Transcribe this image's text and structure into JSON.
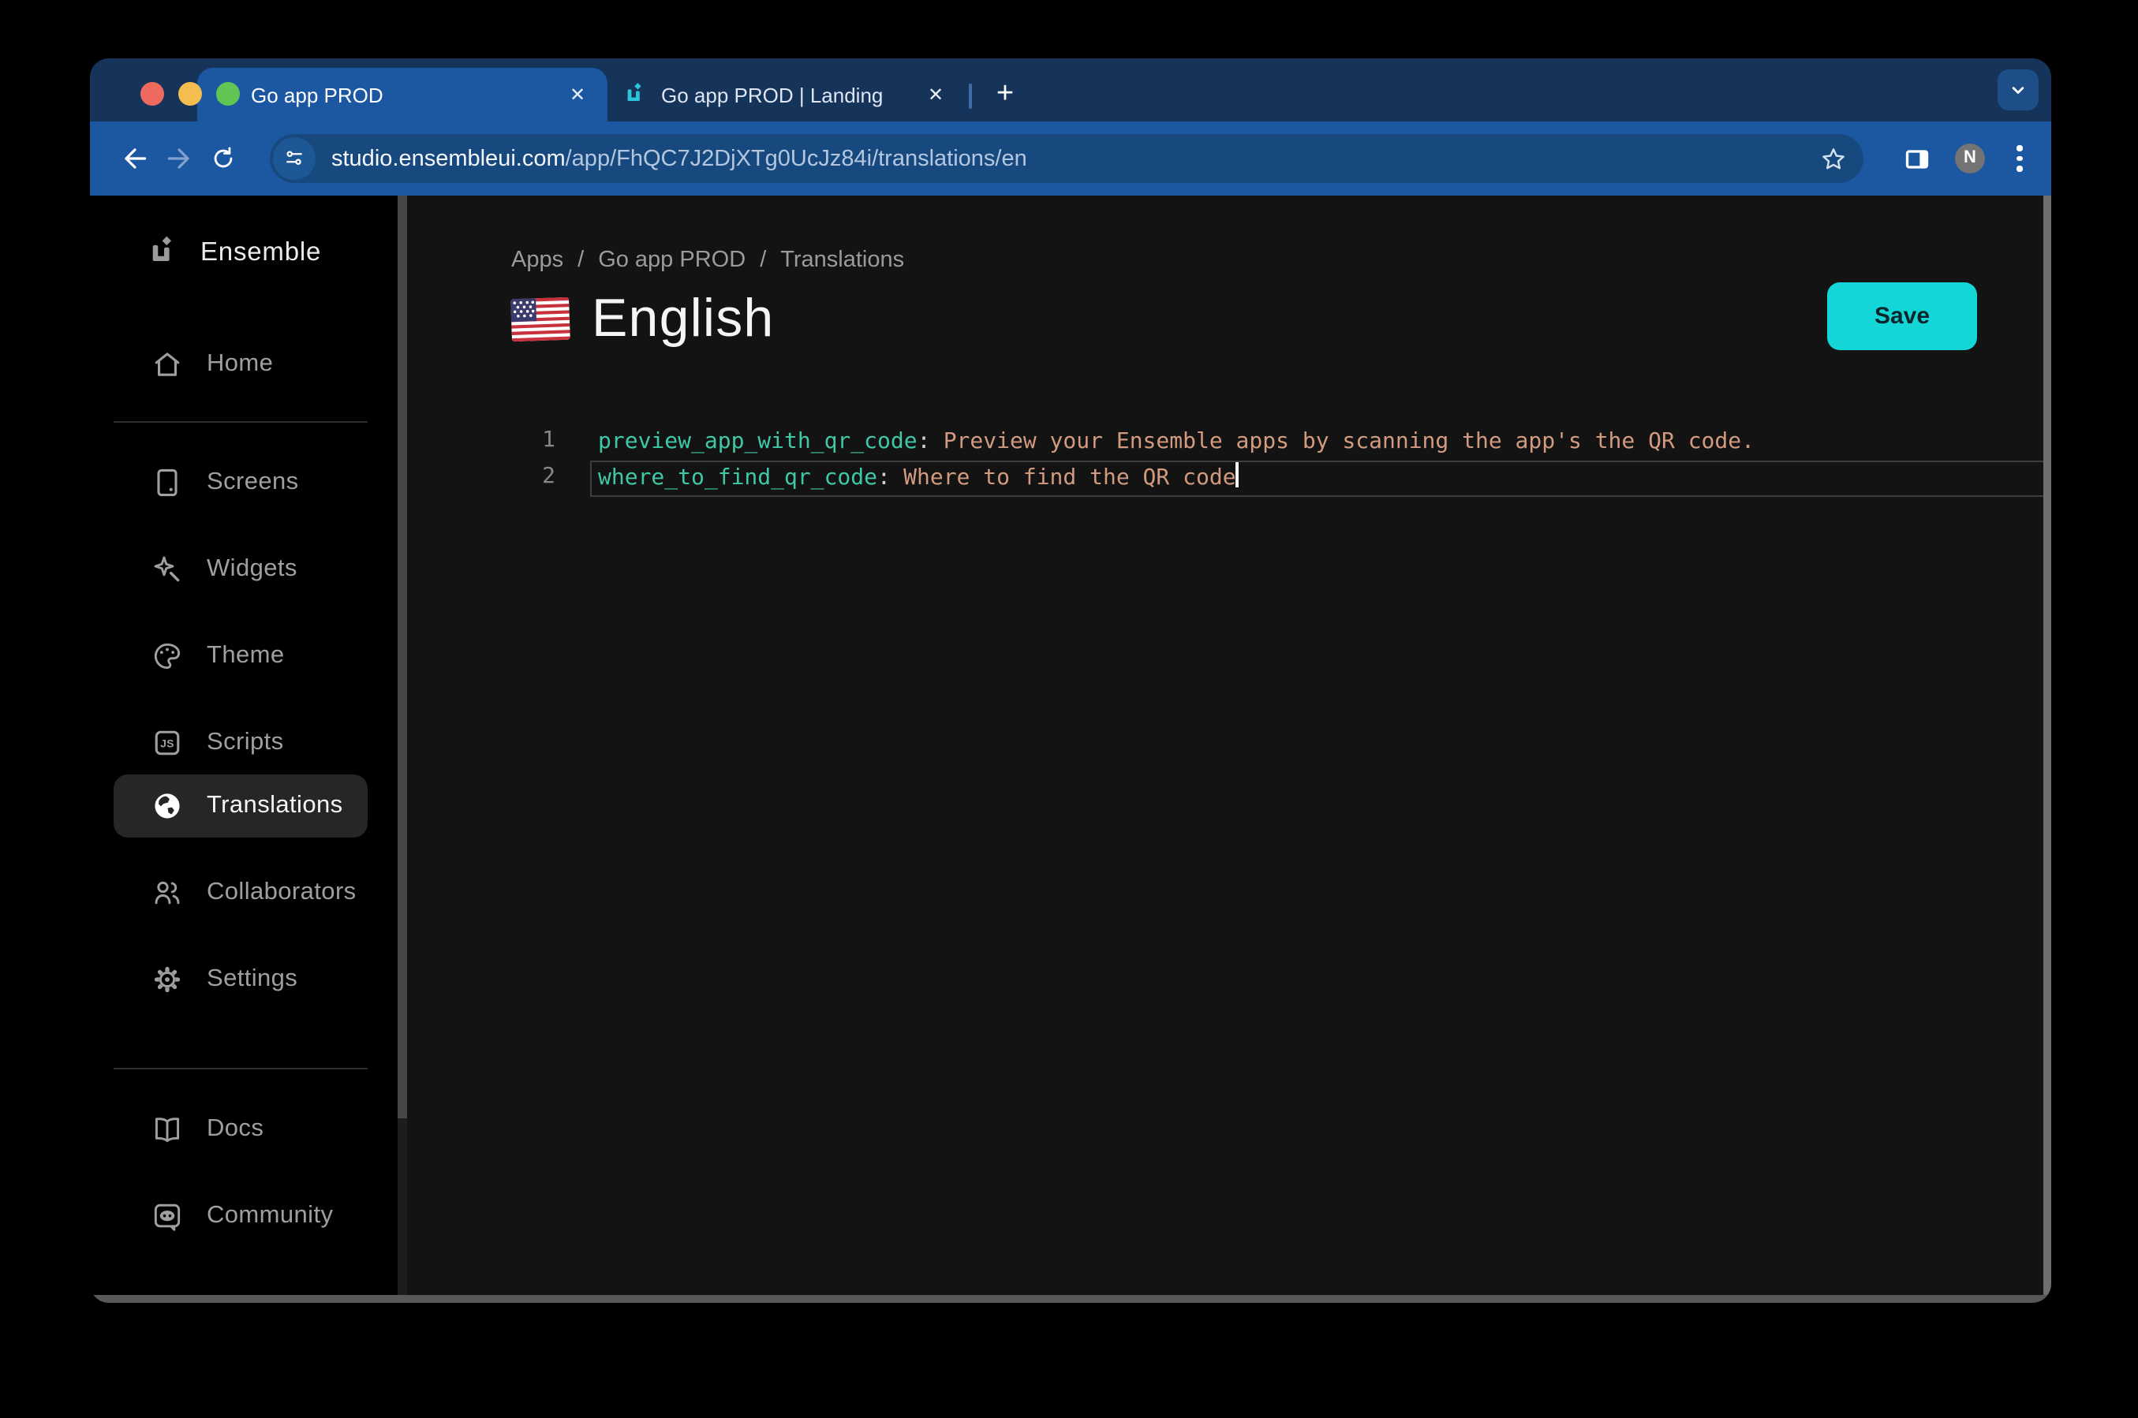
{
  "browser": {
    "tabs": [
      {
        "title": "Go app PROD",
        "active": true
      },
      {
        "title": "Go app PROD | Landing",
        "active": false
      }
    ],
    "close_glyph": "✕",
    "new_tab_label": "+",
    "url": {
      "domain": "studio.ensembleui.com",
      "path": "/app/FhQC7J2DjXTg0UcJz84i/translations/en"
    },
    "avatar_initial": "N"
  },
  "sidebar": {
    "brand": "Ensemble",
    "items": [
      {
        "label": "Home",
        "icon": "home-icon",
        "active": false
      },
      {
        "label": "Screens",
        "icon": "screens-icon",
        "active": false
      },
      {
        "label": "Widgets",
        "icon": "widgets-icon",
        "active": false
      },
      {
        "label": "Theme",
        "icon": "theme-icon",
        "active": false
      },
      {
        "label": "Scripts",
        "icon": "scripts-icon",
        "active": false
      },
      {
        "label": "Translations",
        "icon": "globe-icon",
        "active": true
      },
      {
        "label": "Collaborators",
        "icon": "collaborators-icon",
        "active": false
      },
      {
        "label": "Settings",
        "icon": "settings-icon",
        "active": false
      },
      {
        "label": "Docs",
        "icon": "docs-icon",
        "active": false
      },
      {
        "label": "Community",
        "icon": "discord-icon",
        "active": false
      }
    ]
  },
  "main": {
    "breadcrumb": {
      "items": [
        "Apps",
        "Go app PROD",
        "Translations"
      ],
      "separator": "/"
    },
    "flag_icon": "us-flag-icon",
    "title": "English",
    "save_label": "Save",
    "editor": {
      "lines": [
        {
          "number": "1",
          "key": "preview_app_with_qr_code",
          "separator": ":",
          "value": "Preview your Ensemble apps by scanning the app's the QR code.",
          "active": false
        },
        {
          "number": "2",
          "key": "where_to_find_qr_code",
          "separator": ":",
          "value": "Where to find the QR code",
          "active": true
        }
      ]
    }
  },
  "colors": {
    "accent_cyan": "#15d6d6",
    "toolbar_blue": "#1c58a2",
    "tabstrip_navy": "#16335a",
    "key_teal": "#3fc8a8",
    "value_salmon": "#d29a7e",
    "sidebar_bg": "#000000",
    "main_bg": "#131313"
  }
}
